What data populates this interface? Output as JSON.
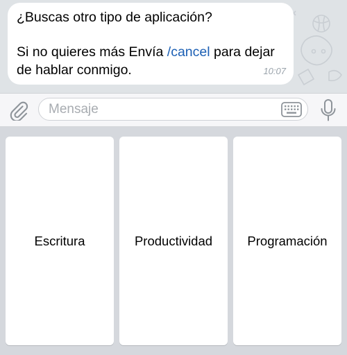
{
  "chat": {
    "message": {
      "line1": "¿Buscas otro tipo de aplicación?",
      "line2_pre": "Si no quieres más Envía ",
      "command": "/cancel",
      "line2_post": " para dejar de hablar conmigo.",
      "time": "10:07"
    }
  },
  "input_bar": {
    "placeholder": "Mensaje",
    "icons": {
      "attach": "paperclip-icon",
      "keyboard": "keyboard-icon",
      "mic": "microphone-icon"
    }
  },
  "reply_keyboard": {
    "buttons": [
      {
        "label": "Escritura"
      },
      {
        "label": "Productividad"
      },
      {
        "label": "Programación"
      }
    ]
  },
  "colors": {
    "link": "#1b5fb4",
    "chat_background": "#dfe3e6",
    "keyboard_background": "#d5d8dd",
    "icon_gray": "#8e949a"
  }
}
